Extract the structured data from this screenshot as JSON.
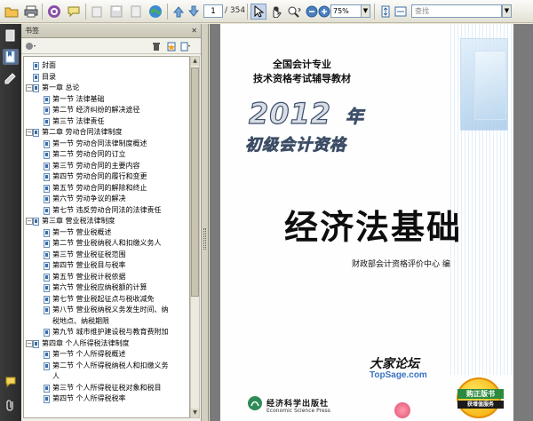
{
  "toolbar": {
    "page_current": "1",
    "page_total": "/ 354",
    "zoom_value": "75%",
    "search_placeholder": "查找"
  },
  "bookmarks_panel": {
    "title": "书签",
    "close": "✕",
    "items": [
      {
        "label": "封面",
        "level": 0,
        "toggle": ""
      },
      {
        "label": "目录",
        "level": 0,
        "toggle": ""
      },
      {
        "label": "第一章 总论",
        "level": 0,
        "toggle": "−"
      },
      {
        "label": "第一节 法律基础",
        "level": 1,
        "toggle": ""
      },
      {
        "label": "第二节 经济纠纷的解决途径",
        "level": 1,
        "toggle": ""
      },
      {
        "label": "第三节 法律责任",
        "level": 1,
        "toggle": ""
      },
      {
        "label": "第二章 劳动合同法律制度",
        "level": 0,
        "toggle": "−"
      },
      {
        "label": "第一节 劳动合同法律制度概述",
        "level": 1,
        "toggle": ""
      },
      {
        "label": "第二节 劳动合同的订立",
        "level": 1,
        "toggle": ""
      },
      {
        "label": "第三节 劳动合同的主要内容",
        "level": 1,
        "toggle": ""
      },
      {
        "label": "第四节 劳动合同的履行和变更",
        "level": 1,
        "toggle": ""
      },
      {
        "label": "第五节 劳动合同的解除和终止",
        "level": 1,
        "toggle": ""
      },
      {
        "label": "第六节 劳动争议的解决",
        "level": 1,
        "toggle": ""
      },
      {
        "label": "第七节 违反劳动合同法的法律责任",
        "level": 1,
        "toggle": ""
      },
      {
        "label": "第三章 营业税法律制度",
        "level": 0,
        "toggle": "−"
      },
      {
        "label": "第一节 营业税概述",
        "level": 1,
        "toggle": ""
      },
      {
        "label": "第二节 营业税纳税人和扣缴义务人",
        "level": 1,
        "toggle": ""
      },
      {
        "label": "第三节 营业税征税范围",
        "level": 1,
        "toggle": ""
      },
      {
        "label": "第四节 营业税目与税率",
        "level": 1,
        "toggle": ""
      },
      {
        "label": "第五节 营业税计税依据",
        "level": 1,
        "toggle": ""
      },
      {
        "label": "第六节 营业税应纳税额的计算",
        "level": 1,
        "toggle": ""
      },
      {
        "label": "第七节 营业税起征点与税收减免",
        "level": 1,
        "toggle": ""
      },
      {
        "label": "第八节 营业税纳税义务发生时间、纳",
        "level": 1,
        "toggle": ""
      },
      {
        "label": "税地点、纳税期限",
        "level": 1,
        "toggle": "",
        "cont": true
      },
      {
        "label": "第九节 城市维护建设税与教育费附加",
        "level": 1,
        "toggle": ""
      },
      {
        "label": "第四章 个人所得税法律制度",
        "level": 0,
        "toggle": "−"
      },
      {
        "label": "第一节 个人所得税概述",
        "level": 1,
        "toggle": ""
      },
      {
        "label": "第二节 个人所得税纳税人和扣缴义务",
        "level": 1,
        "toggle": ""
      },
      {
        "label": "人",
        "level": 1,
        "toggle": "",
        "cont": true
      },
      {
        "label": "第三节 个人所得税征税对象和税目",
        "level": 1,
        "toggle": ""
      },
      {
        "label": "第四节 个人所得税税率",
        "level": 1,
        "toggle": ""
      }
    ]
  },
  "cover": {
    "subtitle_line1": "全国会计专业",
    "subtitle_line2": "技术资格考试辅导教材",
    "year": "2012",
    "year_suffix": "年",
    "level": "初级会计资格",
    "title": "经济法基础",
    "editor": "财政部会计资格评价中心 编",
    "watermark_cn": "大家论坛",
    "watermark_en": "TopSage.com",
    "publisher_cn": "经济科学出版社",
    "publisher_en": "Economic Science Press",
    "badge_line1": "购正版书",
    "badge_line2": "获增值服务"
  },
  "colors": {
    "nav_rail": "#2f2f2f",
    "panel_bg": "#f3f2ea",
    "viewer_bg": "#7a7a7a",
    "accent_blue": "#3a73c2"
  }
}
